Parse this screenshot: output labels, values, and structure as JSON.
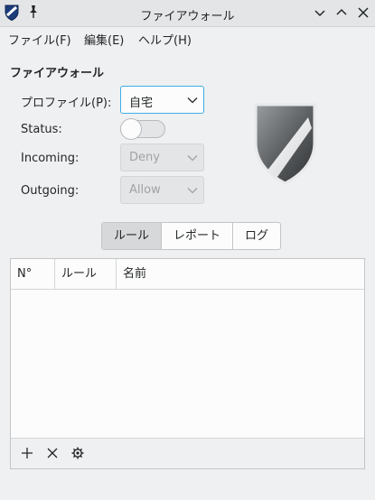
{
  "window": {
    "title": "ファイアウォール"
  },
  "menu": {
    "items": [
      "ファイル(F)",
      "編集(E)",
      "ヘルプ(H)"
    ]
  },
  "firewall": {
    "section_title": "ファイアウォール",
    "profile_label": "プロファイル(P):",
    "profile_value": "自宅",
    "status_label": "Status:",
    "status_on": false,
    "incoming_label": "Incoming:",
    "incoming_value": "Deny",
    "outgoing_label": "Outgoing:",
    "outgoing_value": "Allow"
  },
  "tabs": [
    {
      "label": "ルール",
      "active": true
    },
    {
      "label": "レポート",
      "active": false
    },
    {
      "label": "ログ",
      "active": false
    }
  ],
  "rules_table": {
    "columns": [
      "N°",
      "ルール",
      "名前"
    ],
    "rows": []
  },
  "footer_icons": [
    "add-icon",
    "remove-icon",
    "settings-icon"
  ],
  "colors": {
    "accent": "#3daee9",
    "window_bg": "#eff0f1"
  }
}
